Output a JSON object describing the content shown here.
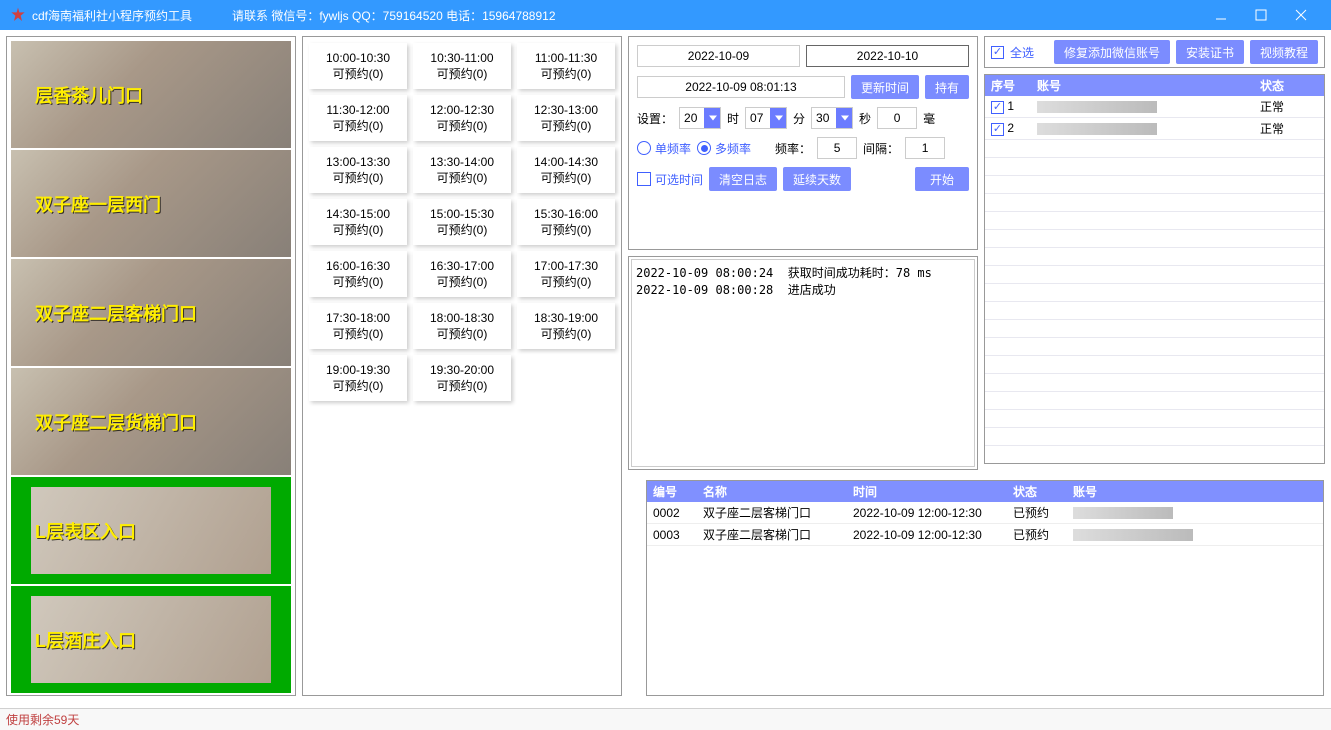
{
  "titlebar": {
    "title": "cdf海南福利社小程序预约工具",
    "contact": "请联系   微信号：fywljs    QQ：759164520   电话：15964788912"
  },
  "locations": [
    {
      "label": "层香茶儿门口",
      "green": false
    },
    {
      "label": "双子座一层西门",
      "green": false
    },
    {
      "label": "双子座二层客梯门口",
      "green": false
    },
    {
      "label": "双子座二层货梯门口",
      "green": false
    },
    {
      "label": "L层表区入口",
      "green": true
    },
    {
      "label": "L层酒庄入口",
      "green": true
    }
  ],
  "slots": [
    {
      "time": "10:00-10:30",
      "sub": "可预约(0)"
    },
    {
      "time": "10:30-11:00",
      "sub": "可预约(0)"
    },
    {
      "time": "11:00-11:30",
      "sub": "可预约(0)"
    },
    {
      "time": "11:30-12:00",
      "sub": "可预约(0)"
    },
    {
      "time": "12:00-12:30",
      "sub": "可预约(0)"
    },
    {
      "time": "12:30-13:00",
      "sub": "可预约(0)"
    },
    {
      "time": "13:00-13:30",
      "sub": "可预约(0)"
    },
    {
      "time": "13:30-14:00",
      "sub": "可预约(0)"
    },
    {
      "time": "14:00-14:30",
      "sub": "可预约(0)"
    },
    {
      "time": "14:30-15:00",
      "sub": "可预约(0)"
    },
    {
      "time": "15:00-15:30",
      "sub": "可预约(0)"
    },
    {
      "time": "15:30-16:00",
      "sub": "可预约(0)"
    },
    {
      "time": "16:00-16:30",
      "sub": "可预约(0)"
    },
    {
      "time": "16:30-17:00",
      "sub": "可预约(0)"
    },
    {
      "time": "17:00-17:30",
      "sub": "可预约(0)"
    },
    {
      "time": "17:30-18:00",
      "sub": "可预约(0)"
    },
    {
      "time": "18:00-18:30",
      "sub": "可预约(0)"
    },
    {
      "time": "18:30-19:00",
      "sub": "可预约(0)"
    },
    {
      "time": "19:00-19:30",
      "sub": "可预约(0)"
    },
    {
      "time": "19:30-20:00",
      "sub": "可预约(0)"
    }
  ],
  "ctrl": {
    "date1": "2022-10-09",
    "date2": "2022-10-10",
    "now": "2022-10-09 08:01:13",
    "btn_update": "更新时间",
    "btn_hold": "持有",
    "set_label": "设置：",
    "hour": "20",
    "hour_lbl": "时",
    "min": "07",
    "min_lbl": "分",
    "sec": "30",
    "sec_lbl": "秒",
    "ms": "0",
    "ms_lbl": "毫",
    "radio_single": "单频率",
    "radio_multi": "多频率",
    "freq_lbl": "频率：",
    "freq": "5",
    "interval_lbl": "间隔：",
    "interval": "1",
    "chk_optional": "可选时间",
    "btn_clear": "清空日志",
    "btn_delay": "延续天数",
    "btn_start": "开始"
  },
  "log_text": "2022-10-09 08:00:24  获取时间成功耗时：78 ms\n2022-10-09 08:00:28  进店成功",
  "appt_table": {
    "headers": [
      "编号",
      "名称",
      "时间",
      "状态",
      "账号"
    ],
    "rows": [
      {
        "id": "0002",
        "name": "双子座二层客梯门口",
        "time": "2022-10-09 12:00-12:30",
        "status": "已预约",
        "acct": "***-10*****"
      },
      {
        "id": "0003",
        "name": "双子座二层客梯门口",
        "time": "2022-10-09 12:00-12:30",
        "status": "已预约",
        "acct": "***********"
      }
    ]
  },
  "acct_top": {
    "select_all": "全选",
    "btn_fix": "修复添加微信账号",
    "btn_cert": "安装证书",
    "btn_video": "视频教程"
  },
  "acct_table": {
    "headers": [
      "序号",
      "账号",
      "状态"
    ],
    "rows": [
      {
        "checked": true,
        "idx": "1",
        "acct": "*****",
        "status": "正常"
      },
      {
        "checked": true,
        "idx": "2",
        "acct": "*****",
        "status": "正常"
      }
    ]
  },
  "statusbar": "使用剩余59天"
}
